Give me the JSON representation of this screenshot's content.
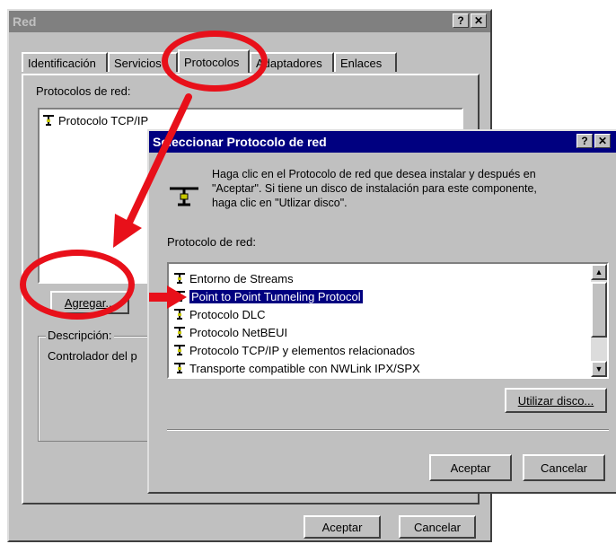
{
  "main_dialog": {
    "title": "Red",
    "help_glyph": "?",
    "close_glyph": "✕",
    "tabs": [
      "Identificación",
      "Servicios",
      "Protocolos",
      "Adaptadores",
      "Enlaces"
    ],
    "active_tab": "Protocolos",
    "list_label": "Protocolos de red:",
    "installed": [
      "Protocolo TCP/IP"
    ],
    "add_button": "Agregar...",
    "description_label": "Descripción:",
    "description_text": "Controlador del p",
    "ok_button": "Aceptar",
    "cancel_button": "Cancelar"
  },
  "select_dialog": {
    "title": "Seleccionar Protocolo de red",
    "help_glyph": "?",
    "close_glyph": "✕",
    "instructions": [
      "Haga clic en el Protocolo de red que desea instalar y después en",
      "\"Aceptar\". Si tiene un disco de instalación para este componente,",
      "haga clic en \"Utlizar disco\"."
    ],
    "list_label": "Protocolo de red:",
    "items": [
      "Entorno de Streams",
      "Point to Point Tunneling Protocol",
      "Protocolo DLC",
      "Protocolo NetBEUI",
      "Protocolo TCP/IP y elementos relacionados",
      "Transporte compatible con NWLink IPX/SPX"
    ],
    "selected_index": 1,
    "disk_button": "Utilizar disco...",
    "ok_button": "Aceptar",
    "cancel_button": "Cancelar"
  },
  "annotation": {
    "color": "#e8101a"
  },
  "icons": {
    "network_protocol": "network-protocol-icon",
    "scroll_up": "scroll-up-icon",
    "scroll_down": "scroll-down-icon"
  }
}
